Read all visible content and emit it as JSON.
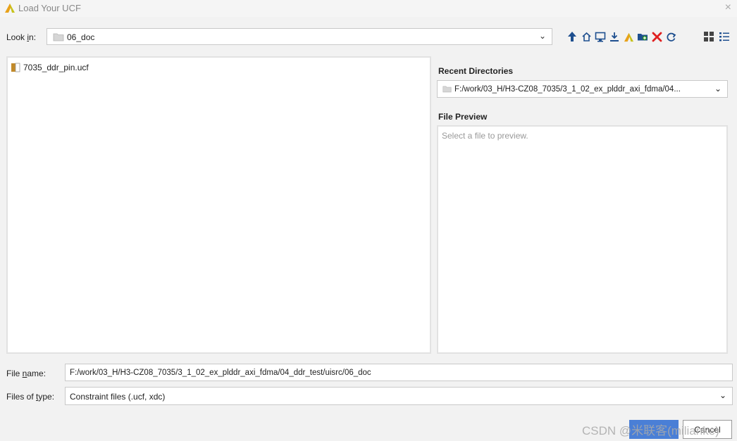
{
  "window": {
    "title": "Load Your UCF",
    "close_glyph": "×"
  },
  "look_in": {
    "label_before": "Look ",
    "label_mnemonic": "i",
    "label_after": "n:",
    "value": "06_doc",
    "dropdown_glyph": "⌄"
  },
  "toolbar": {
    "buttons": [
      {
        "icon": "up-arrow-icon"
      },
      {
        "icon": "home-icon"
      },
      {
        "icon": "desktop-icon"
      },
      {
        "icon": "download-icon"
      },
      {
        "icon": "vivado-icon"
      },
      {
        "icon": "new-folder-icon"
      },
      {
        "icon": "delete-icon"
      },
      {
        "icon": "refresh-icon"
      },
      {
        "icon": "thumbnail-view-icon"
      },
      {
        "icon": "list-view-icon"
      }
    ]
  },
  "file_list": {
    "items": [
      "7035_ddr_pin.ucf"
    ]
  },
  "recent_directories": {
    "label": "Recent Directories",
    "value": "F:/work/03_H/H3-CZ08_7035/3_1_02_ex_plddr_axi_fdma/04...",
    "dropdown_glyph": "⌄"
  },
  "file_preview": {
    "label": "File Preview",
    "placeholder": "Select a file to preview."
  },
  "file_name": {
    "label_before": "File ",
    "label_mnemonic": "n",
    "label_after": "ame:",
    "value": "F:/work/03_H/H3-CZ08_7035/3_1_02_ex_plddr_axi_fdma/04_ddr_test/uisrc/06_doc"
  },
  "files_of_type": {
    "label_before": "Files of ",
    "label_mnemonic": "t",
    "label_after": "ype:",
    "value": "Constraint files (.ucf, xdc)",
    "dropdown_glyph": "⌄"
  },
  "buttons": {
    "cancel_label": "Cancel"
  },
  "watermark": "CSDN @米联客(milianke)",
  "colors": {
    "accent": "#4a7fd6",
    "delete": "#e02020",
    "toolbar_icon": "#1e4f8f",
    "folder": "#c9c9c9",
    "vivado": "#e0a020"
  }
}
